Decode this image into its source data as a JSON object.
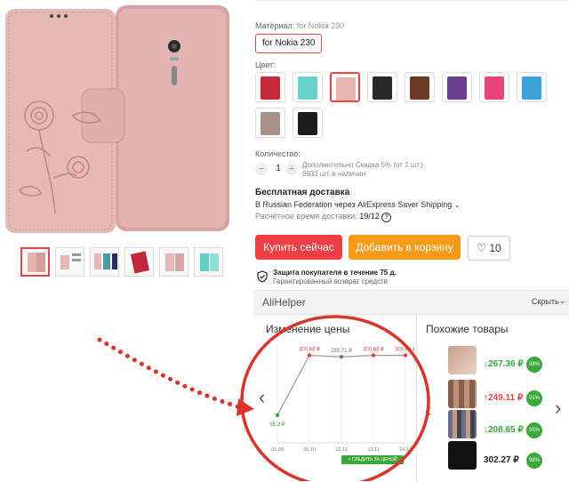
{
  "material": {
    "label": "Материал:",
    "value_inline": "for Nokia 230",
    "option": "for Nokia 230"
  },
  "color": {
    "label": "Цвет:"
  },
  "quantity": {
    "label": "Количество:",
    "minus": "−",
    "value": "1",
    "plus": "+",
    "discount_text": "Дополнительно Скидка 5% (от 2 шт.)",
    "stock_text": "9933 шт. в наличии"
  },
  "shipping": {
    "title": "Бесплатная доставка",
    "route": "В Russian Federation через AliExpress Saver Shipping",
    "eta_label": "Расчётное время доставки:",
    "eta_value": "19/12"
  },
  "actions": {
    "buy": "Купить сейчас",
    "cart": "Добавить в корзину",
    "wishlist_count": "10"
  },
  "protection": {
    "title": "Защита покупателя в течение 75 д.",
    "subtitle": "Гарантированный возврат средств"
  },
  "alihelper": {
    "brand": "AliHelper",
    "hide": "Скрыть",
    "price_history_title": "Изменение цены",
    "similar_title": "Похожие товары",
    "follow_button": "+ СЛЕДИТЬ ЗА ЦЕНОЙ"
  },
  "chart_data": {
    "type": "line",
    "title": "Изменение цены",
    "x": [
      "01.09",
      "26.10",
      "12.11",
      "13.11",
      "14.11"
    ],
    "values": [
      95.2,
      300.68,
      295.71,
      300.68,
      300.68
    ],
    "point_labels": [
      "95.2 ₽",
      "300.68 ₽",
      "295.71 ₽",
      "300.68 ₽",
      "300.68 ₽"
    ],
    "ylim": [
      0,
      330
    ],
    "grid": true,
    "colors": {
      "line": "#999999",
      "low": "#3aa83a",
      "high": "#e64545",
      "mid": "#777777"
    }
  },
  "similar": [
    {
      "price": "↓267.36 ₽",
      "score": "98%",
      "color": "#3aa83a"
    },
    {
      "price": "↑249.11 ₽",
      "score": "91%",
      "color": "#e64545"
    },
    {
      "price": "↓208.65 ₽",
      "score": "95%",
      "color": "#3aa83a"
    },
    {
      "price": "302.27 ₽",
      "score": "98%",
      "color": "#222222"
    }
  ],
  "accent_colors": {
    "red": "#f03e45",
    "orange": "#fa9a1a",
    "annotation": "#d9362b",
    "green": "#3aa83a"
  },
  "icons": [
    "help-icon",
    "chevron-down-icon",
    "shield-check-icon",
    "heart-icon",
    "chevron-left-icon",
    "chevron-right-icon"
  ]
}
